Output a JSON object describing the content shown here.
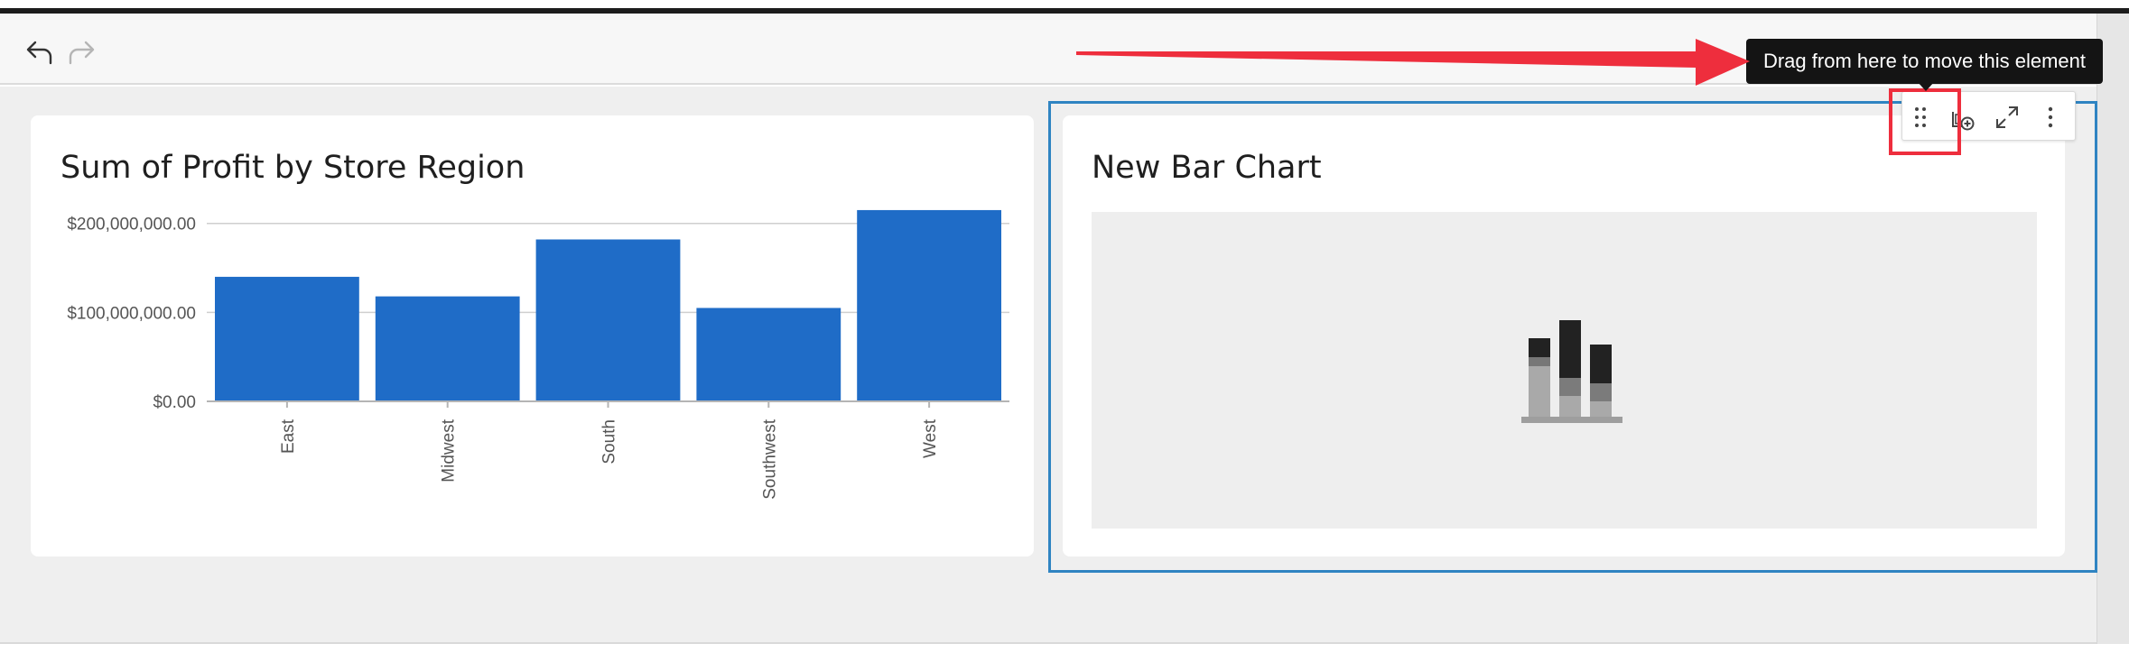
{
  "toolbar": {
    "undo_icon": "undo-arrow-icon",
    "redo_icon": "redo-arrow-icon"
  },
  "cards": [
    {
      "title": "Sum of Profit by Store Region"
    },
    {
      "title": "New Bar Chart",
      "placeholder_icon": "stacked-bar-chart-icon"
    }
  ],
  "chart_data": {
    "type": "bar",
    "title": "Sum of Profit by Store Region",
    "xlabel": "",
    "ylabel": "",
    "categories": [
      "East",
      "Midwest",
      "South",
      "Southwest",
      "West"
    ],
    "values": [
      140000000,
      118000000,
      182000000,
      105000000,
      215000000
    ],
    "ylim": [
      0,
      220000000
    ],
    "yticks": [
      0,
      100000000,
      200000000
    ],
    "ytick_labels": [
      "$0.00",
      "$100,000,000.00",
      "$200,000,000.00"
    ],
    "grid": true,
    "colors": {
      "bar": "#1f6cc7"
    }
  },
  "element_toolbar": {
    "tooltip": "Drag from here to move this element",
    "icons": [
      "drag-handle-icon",
      "add-element-icon",
      "expand-icon",
      "more-options-icon"
    ]
  },
  "annotation": {
    "color": "#ee2e3d"
  },
  "colors": {
    "selection": "#2f84c2",
    "canvas": "#efefef"
  }
}
